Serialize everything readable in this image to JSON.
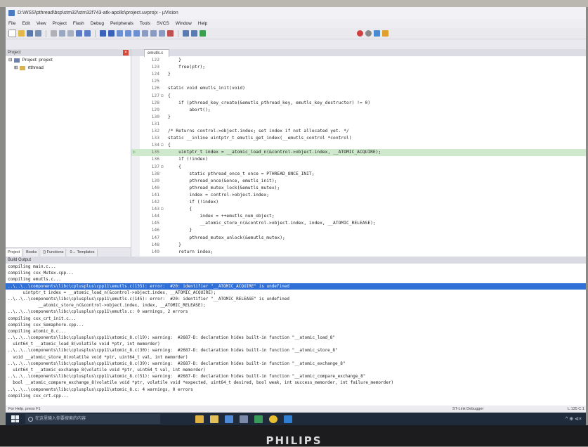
{
  "window": {
    "title": "D:\\WSS\\pthread\\bsp\\stm32\\stm32f743-atk-apollo\\project.uvprojx - µVision"
  },
  "menu": [
    "File",
    "Edit",
    "View",
    "Project",
    "Flash",
    "Debug",
    "Peripherals",
    "Tools",
    "SVCS",
    "Window",
    "Help"
  ],
  "toolbar": {
    "target": "rtthread"
  },
  "project_pane": {
    "title": "Project",
    "root": "Project: project",
    "child": "rtthread",
    "tabs": [
      "Project",
      "Books",
      "{} Functions",
      "0→ Templates"
    ]
  },
  "editor": {
    "file_tab": "emutls.c",
    "lines": [
      {
        "n": "122",
        "fold": "",
        "code": "    }",
        "hl": false,
        "arrow": false
      },
      {
        "n": "123",
        "fold": "",
        "code": "    free(ptr);",
        "hl": false,
        "arrow": false
      },
      {
        "n": "124",
        "fold": "",
        "code": "}",
        "hl": false,
        "arrow": false
      },
      {
        "n": "125",
        "fold": "",
        "code": "",
        "hl": false,
        "arrow": false
      },
      {
        "n": "126",
        "fold": "",
        "code": "static void emutls_init(void)",
        "hl": false,
        "arrow": false
      },
      {
        "n": "127",
        "fold": "⊟",
        "code": "{",
        "hl": false,
        "arrow": false
      },
      {
        "n": "128",
        "fold": "",
        "code": "    if (pthread_key_create(&emutls_pthread_key, emutls_key_destructor) != 0)",
        "hl": false,
        "arrow": false
      },
      {
        "n": "129",
        "fold": "",
        "code": "        abort();",
        "hl": false,
        "arrow": false
      },
      {
        "n": "130",
        "fold": "",
        "code": "}",
        "hl": false,
        "arrow": false
      },
      {
        "n": "131",
        "fold": "",
        "code": "",
        "hl": false,
        "arrow": false
      },
      {
        "n": "132",
        "fold": "",
        "code": "/* Returns control->object.index; set index if not allocated yet. */",
        "hl": false,
        "arrow": false
      },
      {
        "n": "133",
        "fold": "",
        "code": "static __inline uintptr_t emutls_get_index(__emutls_control *control)",
        "hl": false,
        "arrow": false
      },
      {
        "n": "134",
        "fold": "⊟",
        "code": "{",
        "hl": false,
        "arrow": false
      },
      {
        "n": "135",
        "fold": "",
        "code": "    uintptr_t index = __atomic_load_n(&control->object.index, __ATOMIC_ACQUIRE);",
        "hl": true,
        "arrow": true
      },
      {
        "n": "136",
        "fold": "",
        "code": "    if (!index)",
        "hl": false,
        "arrow": false
      },
      {
        "n": "137",
        "fold": "⊟",
        "code": "    {",
        "hl": false,
        "arrow": false
      },
      {
        "n": "138",
        "fold": "",
        "code": "        static pthread_once_t once = PTHREAD_ONCE_INIT;",
        "hl": false,
        "arrow": false
      },
      {
        "n": "139",
        "fold": "",
        "code": "        pthread_once(&once, emutls_init);",
        "hl": false,
        "arrow": false
      },
      {
        "n": "140",
        "fold": "",
        "code": "        pthread_mutex_lock(&emutls_mutex);",
        "hl": false,
        "arrow": false
      },
      {
        "n": "141",
        "fold": "",
        "code": "        index = control->object.index;",
        "hl": false,
        "arrow": false
      },
      {
        "n": "142",
        "fold": "",
        "code": "        if (!index)",
        "hl": false,
        "arrow": false
      },
      {
        "n": "143",
        "fold": "⊟",
        "code": "        {",
        "hl": false,
        "arrow": false
      },
      {
        "n": "144",
        "fold": "",
        "code": "            index = ++emutls_num_object;",
        "hl": false,
        "arrow": false
      },
      {
        "n": "145",
        "fold": "",
        "code": "            __atomic_store_n(&control->object.index, index, __ATOMIC_RELEASE);",
        "hl": false,
        "arrow": false
      },
      {
        "n": "146",
        "fold": "",
        "code": "        }",
        "hl": false,
        "arrow": false
      },
      {
        "n": "147",
        "fold": "",
        "code": "        pthread_mutex_unlock(&emutls_mutex);",
        "hl": false,
        "arrow": false
      },
      {
        "n": "148",
        "fold": "",
        "code": "    }",
        "hl": false,
        "arrow": false
      },
      {
        "n": "149",
        "fold": "",
        "code": "    return index;",
        "hl": false,
        "arrow": false
      }
    ]
  },
  "build_output": {
    "title": "Build Output",
    "lines": [
      {
        "text": "compiling main.c...",
        "sel": false
      },
      {
        "text": "compiling cxx_Mutex.cpp...",
        "sel": false
      },
      {
        "text": "compiling emutls.c...",
        "sel": false
      },
      {
        "text": "..\\..\\..\\components\\libc\\cplusplus\\cpp11\\emutls.c(135): error:  #20: identifier \"__ATOMIC_ACQUIRE\" is undefined",
        "sel": true
      },
      {
        "text": "      uintptr_t index = __atomic_load_n(&control->object.index, __ATOMIC_ACQUIRE);",
        "sel": false
      },
      {
        "text": "..\\..\\..\\components\\libc\\cplusplus\\cpp11\\emutls.c(145): error:  #20: identifier \"__ATOMIC_RELEASE\" is undefined",
        "sel": false
      },
      {
        "text": "            __atomic_store_n(&control->object.index, index, __ATOMIC_RELEASE);",
        "sel": false
      },
      {
        "text": "..\\..\\..\\components\\libc\\cplusplus\\cpp11\\emutls.c: 0 warnings, 2 errors",
        "sel": false
      },
      {
        "text": "compiling cxx_crt_init.c...",
        "sel": false
      },
      {
        "text": "compiling cxx_Semaphore.cpp...",
        "sel": false
      },
      {
        "text": "compiling atomic_8.c...",
        "sel": false
      },
      {
        "text": "..\\..\\..\\components\\libc\\cplusplus\\cpp11\\atomic_8.c(19): warning:  #2687-D: declaration hides built-in function \"__atomic_load_8\"",
        "sel": false
      },
      {
        "text": "  uint64_t __atomic_load_8(volatile void *ptr, int memorder)",
        "sel": false
      },
      {
        "text": "..\\..\\..\\components\\libc\\cplusplus\\cpp11\\atomic_8.c(30): warning:  #2687-D: declaration hides built-in function \"__atomic_store_8\"",
        "sel": false
      },
      {
        "text": "  void __atomic_store_8(volatile void *ptr, uint64_t val, int memorder)",
        "sel": false
      },
      {
        "text": "..\\..\\..\\components\\libc\\cplusplus\\cpp11\\atomic_8.c(39): warning:  #2687-D: declaration hides built-in function \"__atomic_exchange_8\"",
        "sel": false
      },
      {
        "text": "  uint64_t __atomic_exchange_8(volatile void *ptr, uint64_t val, int memorder)",
        "sel": false
      },
      {
        "text": "..\\..\\..\\components\\libc\\cplusplus\\cpp11\\atomic_8.c(51): warning:  #2687-D: declaration hides built-in function \"__atomic_compare_exchange_8\"",
        "sel": false
      },
      {
        "text": "  bool __atomic_compare_exchange_8(volatile void *ptr, volatile void *expected, uint64_t desired, bool weak, int success_memorder, int failure_memorder)",
        "sel": false
      },
      {
        "text": "..\\..\\..\\components\\libc\\cplusplus\\cpp11\\atomic_8.c: 4 warnings, 0 errors",
        "sel": false
      },
      {
        "text": "compiling cxx_crt.cpp...",
        "sel": false
      }
    ]
  },
  "status": {
    "left": "For Help, press F1",
    "debugger": "ST-Link Debugger",
    "position": "L:135 C:1"
  },
  "taskbar": {
    "search_placeholder": "在这里输入你要搜索的内容",
    "tray": "^ ⊕ ⊲×"
  },
  "monitor_brand": "PHILIPS"
}
